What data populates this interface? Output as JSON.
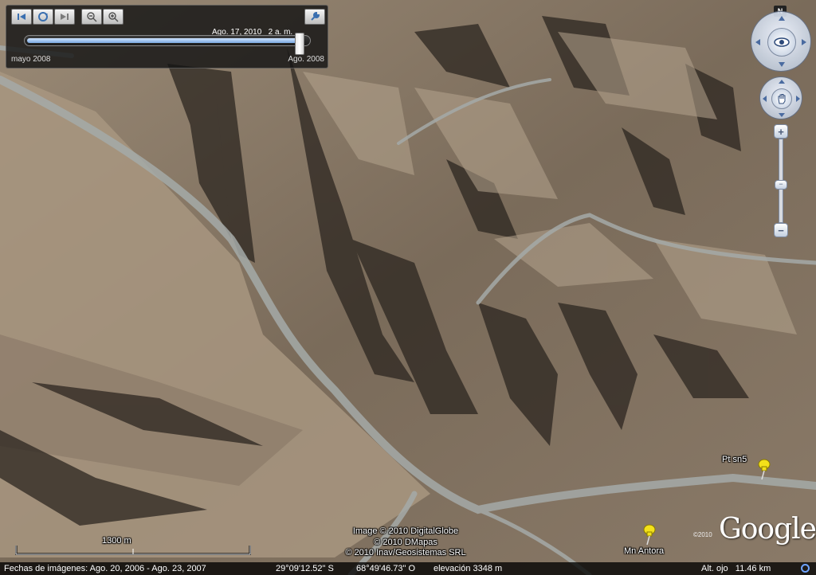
{
  "time_slider": {
    "current_date": "Ago. 17, 2010",
    "current_time": "2 a. m.",
    "start_label": "mayo 2008",
    "end_label": "Ago. 2008",
    "position_fraction": 0.96,
    "buttons": [
      "skip-back-icon",
      "play-icon",
      "skip-forward-icon",
      "zoom-out-time-icon",
      "zoom-in-time-icon"
    ],
    "settings_icon": "wrench-icon"
  },
  "navigation": {
    "north_label": "N",
    "look_icon": "eye-icon",
    "move_icon": "hand-icon",
    "zoom_in": "+",
    "zoom_out": "−",
    "zoom_level_fraction": 0.55
  },
  "placemarks": [
    {
      "label": "Pt sn5",
      "icon": "yellow-pushpin-icon"
    },
    {
      "label": "Mn Antora",
      "icon": "yellow-pushpin-icon"
    }
  ],
  "attribution": {
    "line1": "Image © 2010 DigitalGlobe",
    "line2": "© 2010 DMapas",
    "line3": "© 2010 Inav/Geosistemas SRL"
  },
  "logo": {
    "text": "Google",
    "year": "©2010"
  },
  "scale": {
    "label": "1300 m"
  },
  "status": {
    "image_dates": "Fechas de imágenes: Ago. 20, 2006 - Ago. 23, 2007",
    "latitude": "29°09'12.52\" S",
    "longitude": "68°49'46.73\" O",
    "elevation": "elevación 3348 m",
    "eye_alt": "Alt. ojo   11.46 km"
  },
  "colors": {
    "terrain": "#8a7a66",
    "riverbed": "#9aa0a0",
    "pin": "#f3e11a"
  }
}
